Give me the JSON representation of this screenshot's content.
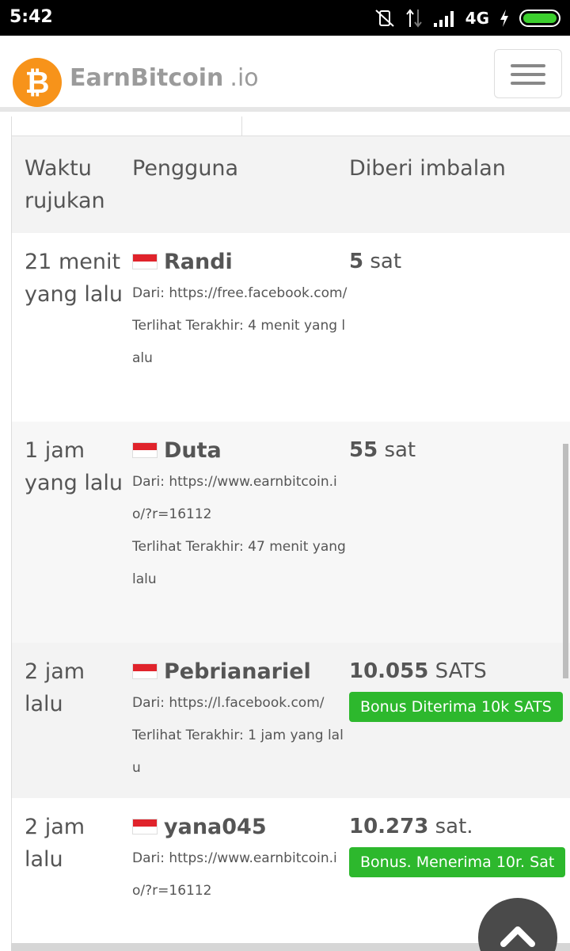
{
  "status_bar": {
    "time": "5:42",
    "network": "4G",
    "icons": [
      "vibrate-off-icon",
      "data-arrows-icon",
      "signal-icon",
      "charging-icon",
      "battery-icon"
    ],
    "battery_color": "#3ccf2e"
  },
  "header": {
    "brand_name": "EarnBitcoin",
    "brand_tld": ".io",
    "logo_symbol": "₿",
    "logo_color": "#f7931a",
    "menu_icon": "hamburger-icon"
  },
  "table": {
    "headers": {
      "time": "Waktu rujukan",
      "user": "Pengguna",
      "reward": "Diberi imbalan"
    },
    "rows": [
      {
        "time": "21 menit yang lalu",
        "user": "Randi",
        "from": "Dari: https://free.facebook.com/",
        "last_seen": "Terlihat Terakhir: 4 menit yang lalu",
        "amount": "5",
        "unit": " sat",
        "badge": ""
      },
      {
        "time": "1 jam yang lalu",
        "user": "Duta",
        "from": "Dari: https://www.earnbitcoin.io/?r=16112",
        "last_seen": "Terlihat Terakhir: 47 menit yang lalu",
        "amount": "55",
        "unit": " sat",
        "badge": ""
      },
      {
        "time": "2 jam lalu",
        "user": "Pebrianariel",
        "from": "Dari: https://l.facebook.com/",
        "last_seen": "Terlihat Terakhir: 1 jam yang lalu",
        "amount": "10.055",
        "unit": " SATS",
        "badge": "Bonus Diterima 10k SATS"
      },
      {
        "time": "2 jam lalu",
        "user": "yana045",
        "from": "Dari: https://www.earnbitcoin.io/?r=16112",
        "last_seen": "",
        "amount": "10.273",
        "unit": " sat.",
        "badge": "Bonus. Menerima 10r. Sat"
      }
    ],
    "badge_color": "#2db82d"
  },
  "scroll_top_icon": "chevron-up-icon"
}
